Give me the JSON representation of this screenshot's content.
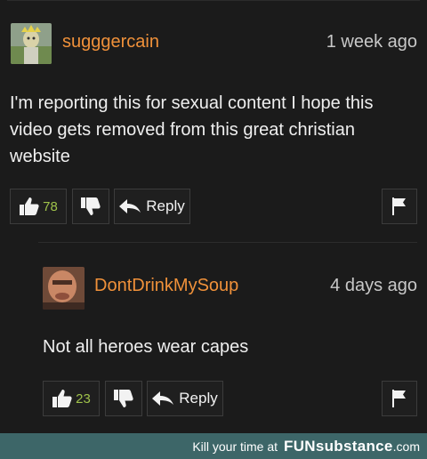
{
  "comments": [
    {
      "username": "sugggercain",
      "timestamp": "1 week ago",
      "text": "I'm reporting this for sexual content I hope this video gets removed from this great christian website",
      "likes": "78",
      "reply_label": "Reply"
    },
    {
      "username": "DontDrinkMySoup",
      "timestamp": "4 days ago",
      "text": "Not all heroes wear capes",
      "likes": "23",
      "reply_label": "Reply"
    }
  ],
  "footer": {
    "text": "Kill your time at",
    "brand": "FUNsubstance",
    "tld": ".com"
  },
  "colors": {
    "background": "#1b1b1b",
    "username": "#f0913a",
    "like_count": "#9fc24a",
    "footer": "#3d6668"
  },
  "icons": [
    "thumbs-up-icon",
    "thumbs-down-icon",
    "reply-arrow-icon",
    "flag-icon"
  ]
}
